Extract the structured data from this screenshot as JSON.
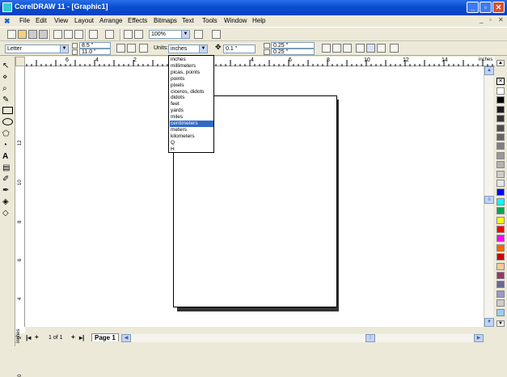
{
  "window": {
    "title": "CorelDRAW 11 - [Graphic1]"
  },
  "menu": [
    "File",
    "Edit",
    "View",
    "Layout",
    "Arrange",
    "Effects",
    "Bitmaps",
    "Text",
    "Tools",
    "Window",
    "Help"
  ],
  "toolbar1": {
    "zoom": "100%"
  },
  "toolbar2": {
    "paper": "Letter",
    "width": "8.5 \"",
    "height": "11.0 \"",
    "units_label": "Units:",
    "units_value": "inches",
    "nudge": "0.1 \"",
    "dup_x": "0.25 \"",
    "dup_y": "0.25 \""
  },
  "units_options": [
    "inches",
    "millimeters",
    "picas, points",
    "points",
    "pixels",
    "ciceros, didots",
    "didots",
    "feet",
    "yards",
    "miles",
    "centimeters",
    "meters",
    "kilometers",
    "Q",
    "H"
  ],
  "units_selected": "centimeters",
  "ruler": {
    "unit": "inches",
    "h_labels": [
      "6",
      "4",
      "2",
      "0",
      "2",
      "4",
      "6",
      "8",
      "10",
      "12",
      "14"
    ],
    "v_labels": [
      "12",
      "10",
      "8",
      "6",
      "4",
      "2",
      "0"
    ]
  },
  "pages": {
    "counter": "1 of 1",
    "tab": "Page 1"
  },
  "palette_colors": [
    "#ffffff",
    "#000000",
    "#1a1a1a",
    "#333333",
    "#4d4d4d",
    "#666666",
    "#808080",
    "#999999",
    "#b3b3b3",
    "#cccccc",
    "#e6e6e6",
    "#0000ff",
    "#00ffff",
    "#00a651",
    "#ffff00",
    "#ff0000",
    "#ff00ff",
    "#ff6600",
    "#cc0000",
    "#ffcc99",
    "#993366",
    "#666699",
    "#9999cc",
    "#cccccc",
    "#99ccff"
  ]
}
